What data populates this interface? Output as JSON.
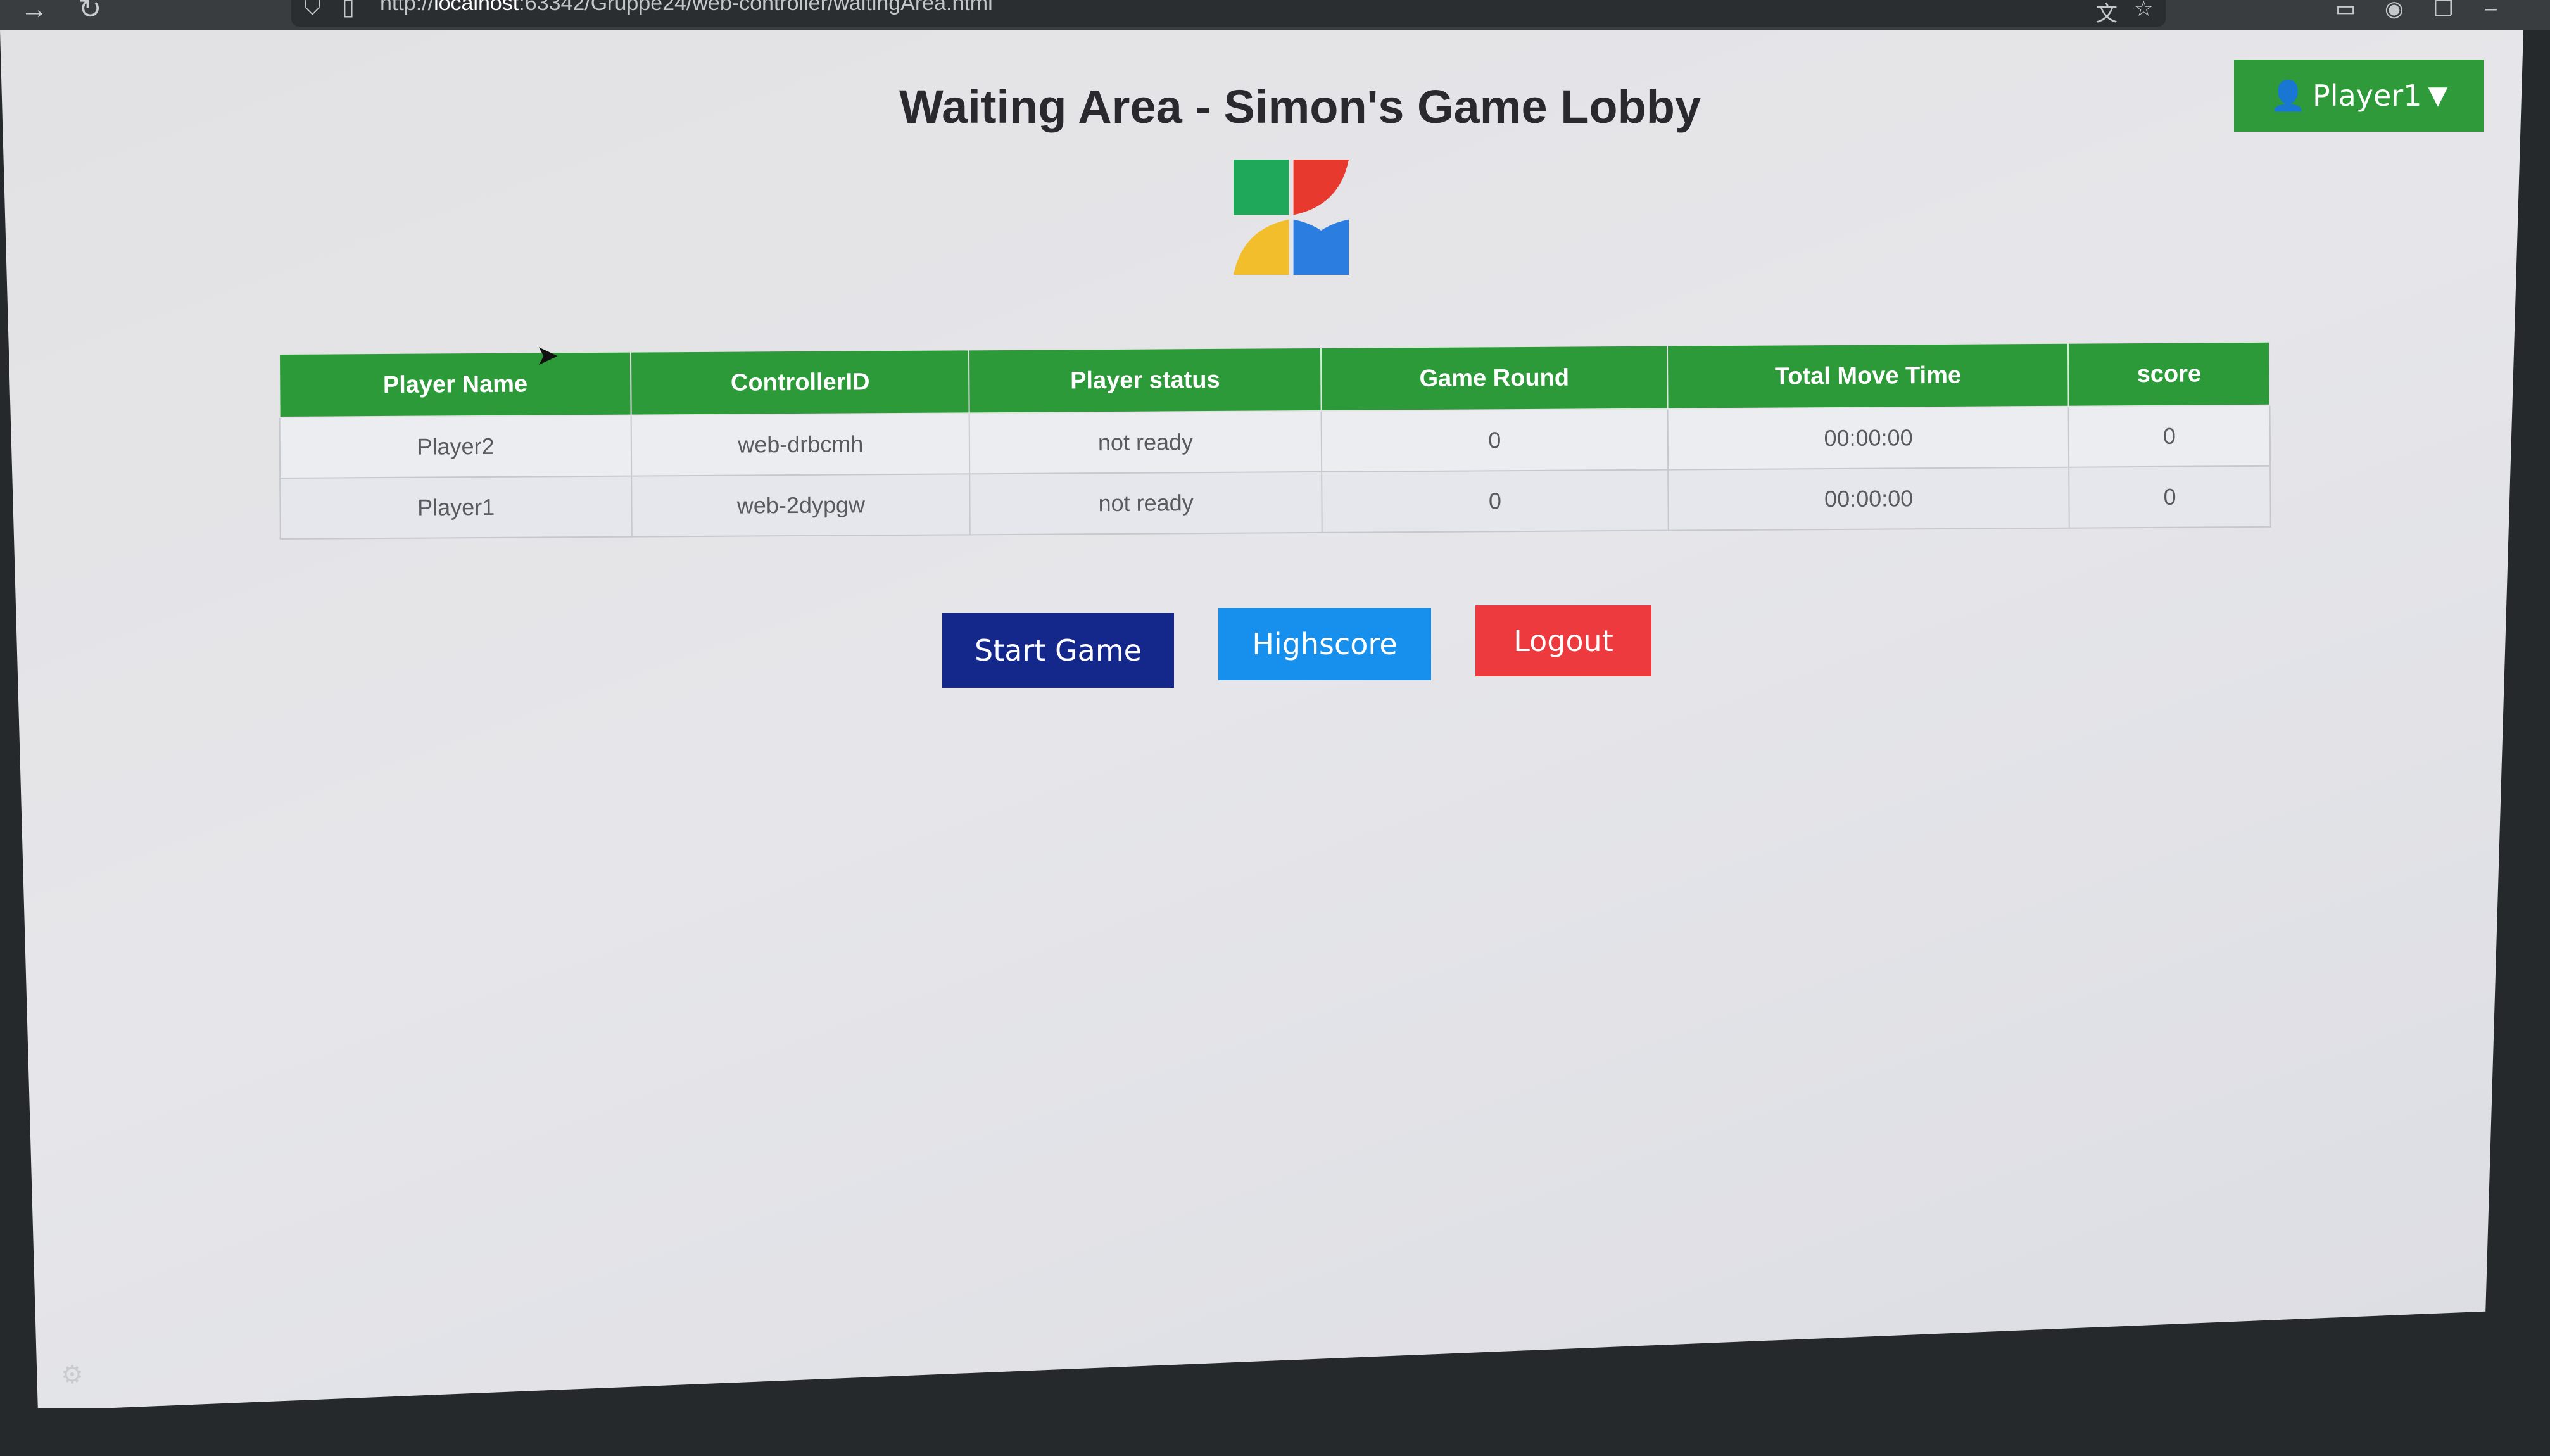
{
  "browser": {
    "url_prefix": "http://",
    "url_host": "localhost",
    "url_rest": ":63342/Gruppe24/web-controller/waitingArea.html"
  },
  "header": {
    "title": "Waiting Area - Simon's Game Lobby",
    "user_menu_label": "Player1",
    "user_icon": "user-icon",
    "caret_icon": "caret-down-icon"
  },
  "logo": {
    "icon": "pinwheel-logo",
    "colors": [
      "#1fa85a",
      "#e8392f",
      "#2b7de0",
      "#f3be2c"
    ]
  },
  "table": {
    "columns": [
      "Player Name",
      "ControllerID",
      "Player status",
      "Game Round",
      "Total Move Time",
      "score"
    ],
    "rows": [
      [
        "Player2",
        "web-drbcmh",
        "not ready",
        "0",
        "00:00:00",
        "0"
      ],
      [
        "Player1",
        "web-2dypgw",
        "not ready",
        "0",
        "00:00:00",
        "0"
      ]
    ]
  },
  "actions": {
    "start": "Start Game",
    "highscore": "Highscore",
    "logout": "Logout"
  },
  "colors": {
    "header_green": "#2c9a39",
    "start_blue": "#14288c",
    "highscore_blue": "#1690ec",
    "logout_red": "#ec3a3f"
  }
}
